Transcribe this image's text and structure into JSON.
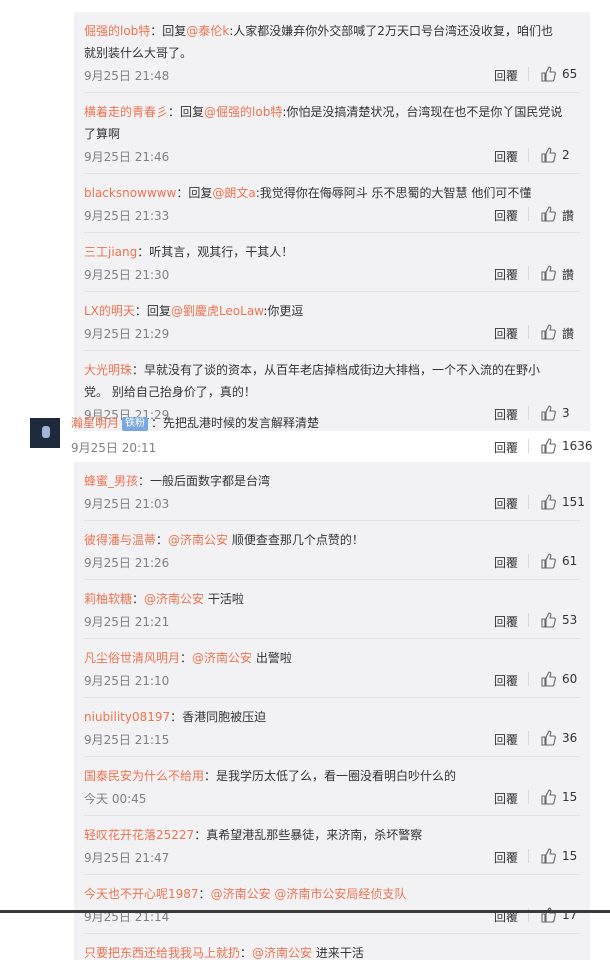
{
  "thread1": [
    {
      "user": "倔强的lob特",
      "mid": "：回复",
      "mention": "@泰伦k",
      "text": ":人家都没嫌弃你外交部喊了2万天口号台湾还没收复，咱们也就别装什么大哥了。",
      "time": "9月25日 21:48",
      "reply": "回覆",
      "likes": "65"
    },
    {
      "user": "横着走的青春彡",
      "mid": "：回复",
      "mention": "@倔强的lob特",
      "text": ":你怕是没搞清楚状况，台湾现在也不是你丫国民党说了算啊",
      "time": "9月25日 21:46",
      "reply": "回覆",
      "likes": "2"
    },
    {
      "user": "blacksnowwww",
      "mid": "：回复",
      "mention": "@朗文a",
      "text": ":我觉得你在侮辱阿斗 乐不思蜀的大智慧 他们可不懂",
      "time": "9月25日 21:33",
      "reply": "回覆",
      "likes": "讚"
    },
    {
      "user": "三工jiang",
      "mid": "：",
      "mention": "",
      "text": "听其言，观其行，干其人！",
      "time": "9月25日 21:30",
      "reply": "回覆",
      "likes": "讚"
    },
    {
      "user": "LX的明天",
      "mid": "：回复",
      "mention": "@劉慶虎LeoLaw",
      "text": ":你更逗",
      "time": "9月25日 21:29",
      "reply": "回覆",
      "likes": "讚"
    },
    {
      "user": "大光明珠",
      "mid": "：",
      "mention": "",
      "text": "早就没有了谈的资本，从百年老店掉档成街边大排档，一个不入流的在野小党。 别给自己抬身价了，真的！",
      "time": "9月25日 21:29",
      "reply": "回覆",
      "likes": "3"
    }
  ],
  "main_comment": {
    "user": "瀚星明月",
    "badge": "铁粉",
    "text": "：先把乱港时候的发言解释清楚",
    "time": "9月25日 20:11",
    "reply": "回覆",
    "likes": "1636"
  },
  "thread2": [
    {
      "user": "蜂蜜_男孩",
      "mid": "：",
      "mention": "",
      "text": "一般后面数字都是台湾",
      "time": "9月25日 21:03",
      "reply": "回覆",
      "likes": "151"
    },
    {
      "user": "彼得潘与温蒂",
      "mid": "：",
      "mention": "@济南公安",
      "text": " 顺便查查那几个点赞的！",
      "time": "9月25日 21:26",
      "reply": "回覆",
      "likes": "61"
    },
    {
      "user": "莉柚软糖",
      "mid": "：",
      "mention": "@济南公安",
      "text": " 干活啦",
      "time": "9月25日 21:21",
      "reply": "回覆",
      "likes": "53"
    },
    {
      "user": "凡尘俗世清风明月",
      "mid": "：",
      "mention": "@济南公安",
      "text": " 出警啦",
      "time": "9月25日 21:10",
      "reply": "回覆",
      "likes": "60"
    },
    {
      "user": "niubility08197",
      "mid": "：",
      "mention": "",
      "text": "香港同胞被压迫",
      "time": "9月25日 21:15",
      "reply": "回覆",
      "likes": "36"
    },
    {
      "user": "国泰民安为什么不给用",
      "mid": "：",
      "mention": "",
      "text": "是我学历太低了么，看一圈没看明白吵什么的",
      "time": "今天 00:45",
      "reply": "回覆",
      "likes": "15"
    },
    {
      "user": "轻叹花开花落25227",
      "mid": "：",
      "mention": "",
      "text": "真希望港乱那些暴徒，来济南，杀坏警察",
      "time": "9月25日 21:47",
      "reply": "回覆",
      "likes": "15"
    },
    {
      "user": "今天也不开心呢1987",
      "mid": "：",
      "mention": "@济南公安 @济南市公安局经侦支队",
      "text": "",
      "time": "9月25日 21:14",
      "reply": "回覆",
      "likes": "17"
    },
    {
      "user": "只要把东西还给我我马上就扔",
      "mid": "：",
      "mention": "@济南公安",
      "text": " 进来干活",
      "time": "",
      "reply": "",
      "likes": ""
    }
  ]
}
